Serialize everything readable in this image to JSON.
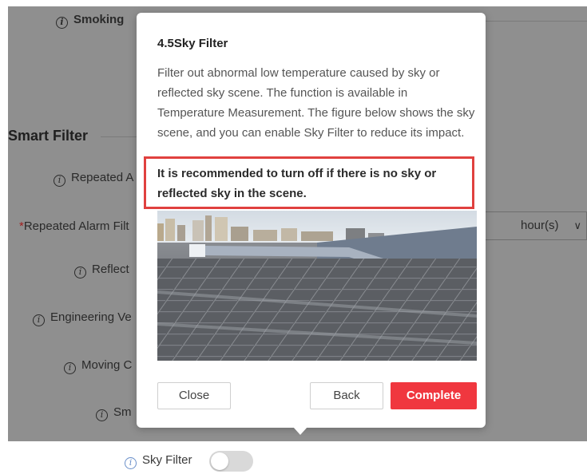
{
  "background": {
    "rows": [
      {
        "label": "Smoking",
        "bold": true
      },
      {
        "label": "Repeated A",
        "bold": false
      },
      {
        "label": "Repeated Alarm Filt",
        "bold": false,
        "required": "*"
      },
      {
        "label": "Reflect",
        "bold": false
      },
      {
        "label": "Engineering Ve",
        "bold": false
      },
      {
        "label": "Moving C",
        "bold": false
      },
      {
        "label": "Sm",
        "bold": false
      }
    ],
    "section_title": "Smart Filter",
    "unit_select": {
      "value": "hour(s)"
    }
  },
  "modal": {
    "title": "4.5Sky Filter",
    "description": "Filter out abnormal low temperature caused by sky or reflected sky scene. The function is available in Temperature Measurement. The figure below shows the sky scene, and you can enable Sky Filter to reduce its impact.",
    "warning": "It is recommended to turn off if there is no sky or reflected sky in the scene.",
    "buttons": {
      "close": "Close",
      "back": "Back",
      "complete": "Complete"
    },
    "accent_color": "#f0373f",
    "highlight_color": "#e0413f"
  },
  "sky_filter": {
    "label": "Sky Filter",
    "enabled": false
  }
}
